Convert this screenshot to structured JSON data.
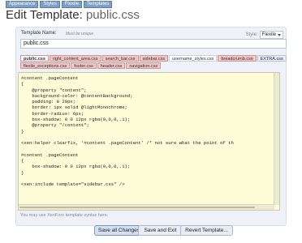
{
  "breadcrumbs": [
    "Appearance",
    "Styles",
    "Flexile",
    "Templates"
  ],
  "page_title": {
    "prefix": "Edit Template:",
    "filename": "public.css"
  },
  "form": {
    "template_name_label": "Template Name:",
    "template_name_hint": "Must be unique",
    "template_name_value": "public.css",
    "style_label": "Style:",
    "style_value": "Flexile"
  },
  "tabs": {
    "row1": [
      {
        "label": "public.css",
        "state": "active"
      },
      {
        "label": "right_content_area.css",
        "state": "modified"
      },
      {
        "label": "search_bar.css",
        "state": "modified"
      },
      {
        "label": "sidebar.css",
        "state": "modified"
      },
      {
        "label": "username_styles.css",
        "state": "plain"
      },
      {
        "label": "breadcrumb.css",
        "state": "modified"
      },
      {
        "label": "EXTRA.css",
        "state": "plain"
      }
    ],
    "row2": [
      {
        "label": "flexile_exceptions.css",
        "state": "modified"
      },
      {
        "label": "footer.css",
        "state": "modified"
      },
      {
        "label": "header.css",
        "state": "modified"
      },
      {
        "label": "navigation.css",
        "state": "modified"
      }
    ]
  },
  "editor": {
    "code": "#content .pageContent\n{\n    @property \"content\";\n    background-color: @contentBackground;\n    padding: 0 20px;\n    border: 1px solid @lightMonochrome;\n    border-radius: 6px;\n    box-shadow: 0 0 12px rgba(0,0,0,.1);\n    @property \"/content\";\n}\n\n<xen:helper clearfix, '#content .pageContent' /* not sure what the point of th\n\n#content .pageContent\n{\n    box-shadow: 0 0 12px rgba(0,0,0,.1);\n}\n\n<xen:include template=\"sidebar.css\" />"
  },
  "note": "You may use XenForo template syntax here.",
  "buttons": {
    "save_all": "Save all Changes",
    "save_exit": "Save and Exit",
    "revert": "Revert Template..."
  },
  "colors": {
    "tab_modified": "#f2c6c6",
    "editor_bg": "#fffdd8",
    "panel_bg": "#eef2f8",
    "crumb_bg": "#7d9fc4"
  }
}
